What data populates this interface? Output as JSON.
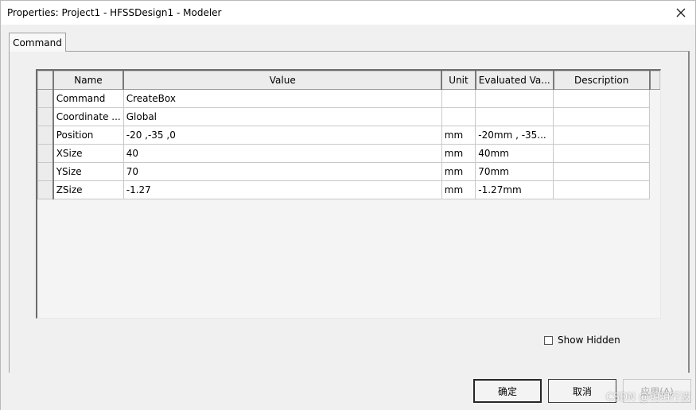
{
  "window": {
    "title": "Properties: Project1 - HFSSDesign1 - Modeler"
  },
  "tabs": [
    {
      "label": "Command",
      "active": true
    }
  ],
  "grid": {
    "columns": [
      "Name",
      "Value",
      "Unit",
      "Evaluated Va...",
      "Description"
    ],
    "rows": [
      {
        "name": "Command",
        "value": "CreateBox",
        "unit": "",
        "evaluated": "",
        "description": ""
      },
      {
        "name": "Coordinate ...",
        "value": "Global",
        "unit": "",
        "evaluated": "",
        "description": ""
      },
      {
        "name": "Position",
        "value": "-20 ,-35 ,0",
        "unit": "mm",
        "evaluated": "-20mm , -35...",
        "description": ""
      },
      {
        "name": "XSize",
        "value": "40",
        "unit": "mm",
        "evaluated": "40mm",
        "description": ""
      },
      {
        "name": "YSize",
        "value": "70",
        "unit": "mm",
        "evaluated": "70mm",
        "description": ""
      },
      {
        "name": "ZSize",
        "value": "-1.27",
        "unit": "mm",
        "evaluated": "-1.27mm",
        "description": ""
      }
    ]
  },
  "options": {
    "show_hidden_label": "Show Hidden",
    "show_hidden_checked": false
  },
  "buttons": {
    "ok": "确定",
    "cancel": "取消",
    "apply": "应用(A)"
  },
  "watermark": "CSDN @玥玥行波"
}
